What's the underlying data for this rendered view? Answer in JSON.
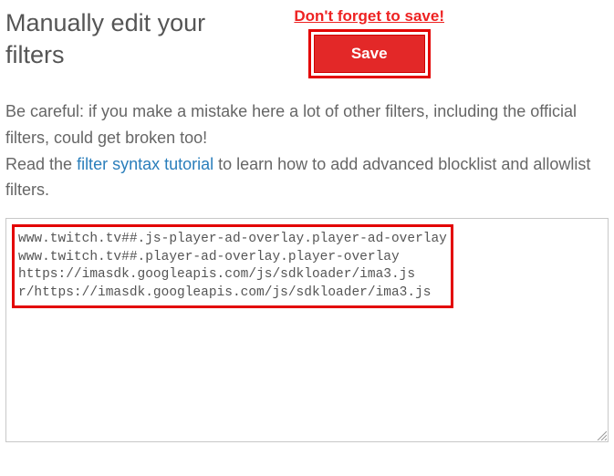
{
  "title": "Manually edit your filters",
  "save_note": "Don't forget to save!",
  "save_label": "Save",
  "warning_pre": "Be careful: if you make a mistake here a lot of other filters, including the official filters, could get broken too!",
  "warning_read": "Read the ",
  "warning_link": "filter syntax tutorial",
  "warning_post": " to learn how to add advanced blocklist and allowlist filters.",
  "filters_text": "www.twitch.tv##.js-player-ad-overlay.player-ad-overlay\nwww.twitch.tv##.player-ad-overlay.player-overlay\nhttps://imasdk.googleapis.com/js/sdkloader/ima3.js\nr/https://imasdk.googleapis.com/js/sdkloader/ima3.js"
}
